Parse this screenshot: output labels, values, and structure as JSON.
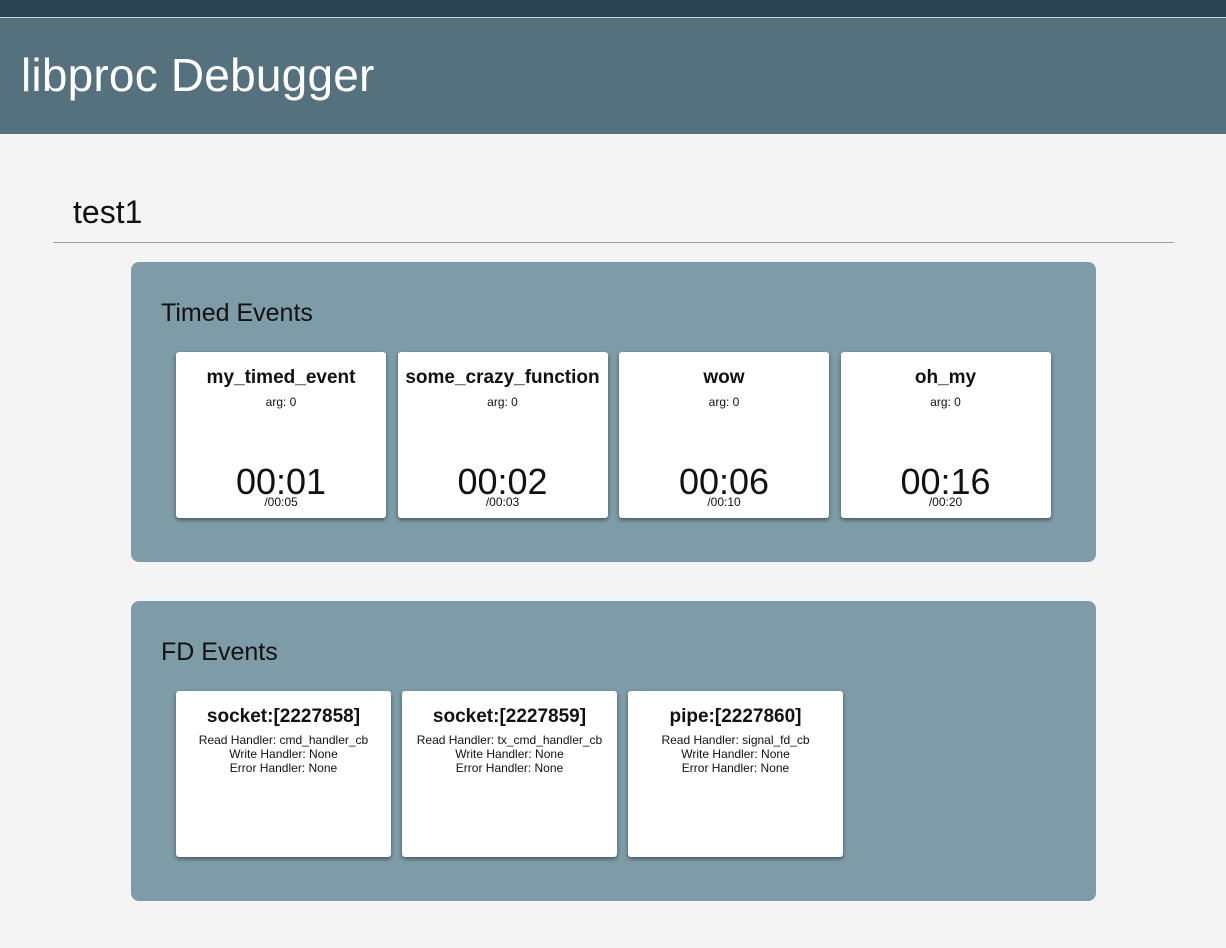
{
  "app": {
    "title": "libproc Debugger"
  },
  "process": {
    "name": "test1"
  },
  "timed_events": {
    "heading": "Timed Events",
    "items": [
      {
        "name": "my_timed_event",
        "arg": "arg: 0",
        "elapsed": "00:01",
        "interval": "/00:05"
      },
      {
        "name": "some_crazy_function",
        "arg": "arg: 0",
        "elapsed": "00:02",
        "interval": "/00:03"
      },
      {
        "name": "wow",
        "arg": "arg: 0",
        "elapsed": "00:06",
        "interval": "/00:10"
      },
      {
        "name": "oh_my",
        "arg": "arg: 0",
        "elapsed": "00:16",
        "interval": "/00:20"
      }
    ]
  },
  "fd_events": {
    "heading": "FD Events",
    "items": [
      {
        "name": "socket:[2227858]",
        "read": "Read Handler: cmd_handler_cb",
        "write": "Write Handler: None",
        "error": "Error Handler: None"
      },
      {
        "name": "socket:[2227859]",
        "read": "Read Handler: tx_cmd_handler_cb",
        "write": "Write Handler: None",
        "error": "Error Handler: None"
      },
      {
        "name": "pipe:[2227860]",
        "read": "Read Handler: signal_fd_cb",
        "write": "Write Handler: None",
        "error": "Error Handler: None"
      }
    ]
  }
}
